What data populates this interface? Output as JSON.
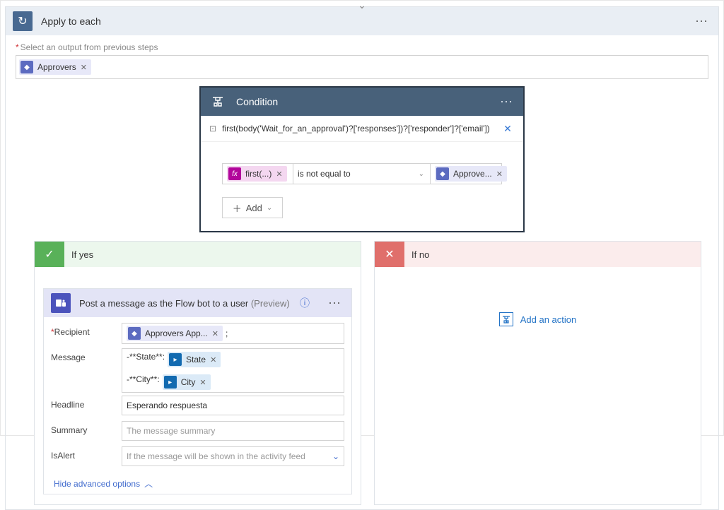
{
  "apply_to_each": {
    "title": "Apply to each",
    "select_output_label": "Select an output from previous steps",
    "output_token": "Approvers"
  },
  "condition": {
    "title": "Condition",
    "expression": "first(body('Wait_for_an_approval')?['responses'])?['responder']?['email'])",
    "left_token": "first(...)",
    "operator": "is not equal to",
    "right_token": "Approve...",
    "add_label": "Add"
  },
  "branches": {
    "yes_label": "If yes",
    "no_label": "If no",
    "add_action_label": "Add an action"
  },
  "post_message": {
    "title": "Post a message as the Flow bot to a user",
    "preview_suffix": "(Preview)",
    "advanced_link": "Hide advanced options",
    "fields": {
      "recipient": {
        "label": "Recipient",
        "token": "Approvers App...",
        "suffix": ";"
      },
      "message": {
        "label": "Message",
        "line1_prefix": "-**State**:",
        "state_token": "State",
        "line2_prefix": "-**City**:",
        "city_token": "City"
      },
      "headline": {
        "label": "Headline",
        "value": "Esperando respuesta"
      },
      "summary": {
        "label": "Summary",
        "placeholder": "The message summary"
      },
      "is_alert": {
        "label": "IsAlert",
        "placeholder": "If the message will be shown in the activity feed"
      }
    }
  }
}
